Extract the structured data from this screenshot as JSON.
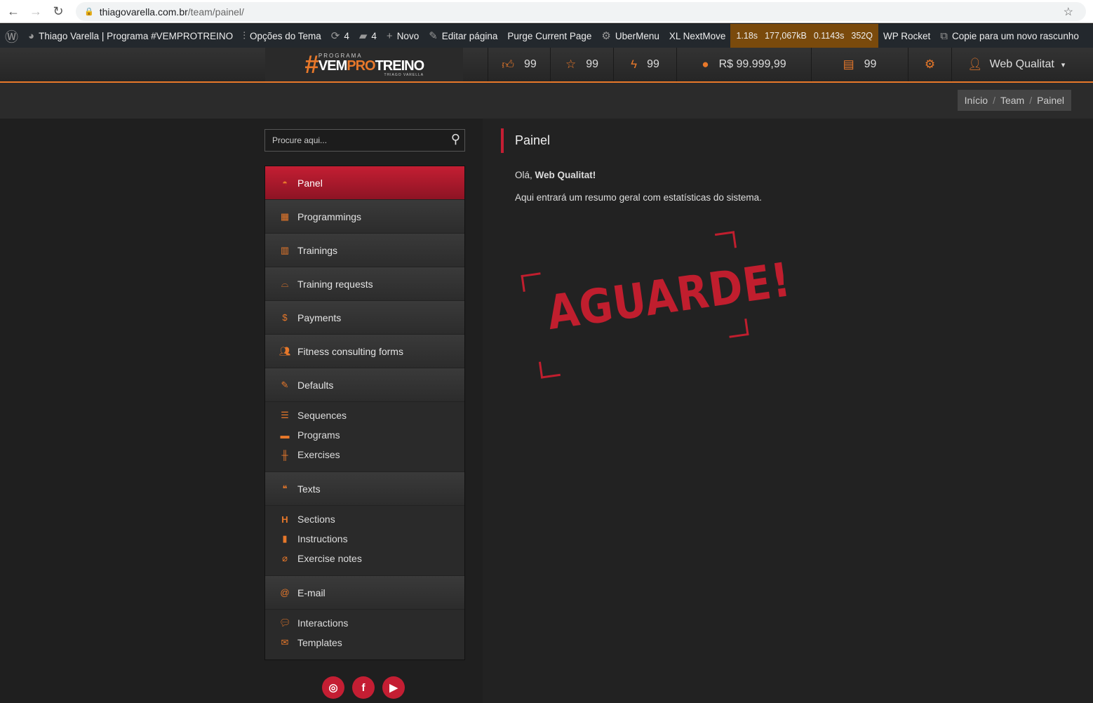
{
  "browser": {
    "url_host": "thiagovarella.com.br",
    "url_path": "/team/painel/"
  },
  "wpbar": {
    "site": "Thiago Varella | Programa #VEMPROTREINO",
    "theme_options": "Opções do Tema",
    "updates": "4",
    "comments": "4",
    "new": "Novo",
    "edit": "Editar página",
    "purge": "Purge Current Page",
    "ubermenu": "UberMenu",
    "nextmove": "XL NextMove",
    "qm": [
      "1.18s",
      "177,067kB",
      "0.1143s",
      "352Q"
    ],
    "rocket": "WP Rocket",
    "copy": "Copie para um novo rascunho"
  },
  "header": {
    "logo_top": "PROGRAMA",
    "logo_a": "VEM",
    "logo_b": "PRO",
    "logo_c": "TREINO",
    "logo_sub": "THIAGO VARELLA",
    "likes": "99",
    "stars": "99",
    "bolts": "99",
    "money": "R$ 99.999,99",
    "docs": "99",
    "user": "Web Qualitat"
  },
  "breadcrumb": [
    "Início",
    "Team",
    "Painel"
  ],
  "search": {
    "placeholder": "Procure aqui..."
  },
  "menu": {
    "panel": "Panel",
    "programmings": "Programmings",
    "trainings": "Trainings",
    "requests": "Training requests",
    "payments": "Payments",
    "fitness": "Fitness consulting forms",
    "defaults": "Defaults",
    "sequences": "Sequences",
    "programs": "Programs",
    "exercises": "Exercises",
    "texts": "Texts",
    "sections": "Sections",
    "instructions": "Instructions",
    "notes": "Exercise notes",
    "email": "E-mail",
    "interactions": "Interactions",
    "templates": "Templates"
  },
  "main": {
    "title": "Painel",
    "greet": "Olá, ",
    "user": "Web Qualitat!",
    "summary": "Aqui entrará um resumo geral com estatísticas do sistema.",
    "stamp": "AGUARDE!"
  },
  "colors": {
    "accent": "#e8782a",
    "brand_red": "#c41e33"
  }
}
